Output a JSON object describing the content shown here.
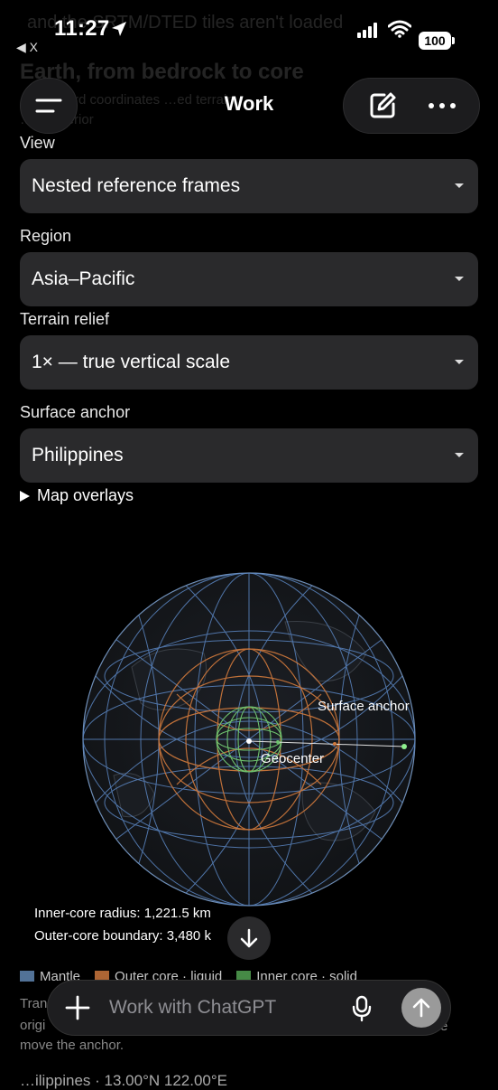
{
  "status": {
    "time": "11:27",
    "back_label": "X",
    "battery": "100"
  },
  "background": {
    "line1": "and the SRTM/DTED tiles aren't loaded",
    "line2": "Earth, from bedrock to core",
    "line3": "…standard coordinates …ed terrain …",
    "line4": "…ed interior"
  },
  "header": {
    "title": "Work"
  },
  "form": {
    "view_label": "View",
    "view_value": "Nested reference frames",
    "region_label": "Region",
    "region_value": "Asia–Pacific",
    "terrain_label": "Terrain relief",
    "terrain_value": "1× — true vertical scale",
    "anchor_label": "Surface anchor",
    "anchor_value": "Philippines",
    "overlays_label": "Map overlays"
  },
  "globe": {
    "surface_anchor_label": "Surface anchor",
    "geocenter_label": "Geocenter",
    "inner_core_text": "Inner-core radius: 1,221.5 km",
    "outer_core_text": "Outer-core boundary: 3,480 k"
  },
  "legend": {
    "items": [
      {
        "label": "Mantle",
        "color": "#5b7fa8"
      },
      {
        "label": "Outer core · liquid",
        "color": "#c0703a"
      },
      {
        "label": "Inner core · solid",
        "color": "#4e9a4e"
      }
    ]
  },
  "partial": {
    "line1": "Tran",
    "line1_tail": "e",
    "line2": "origi",
    "line3": "move the anchor.",
    "bottom": "…ilippines · 13.00°N 122.00°E"
  },
  "composer": {
    "placeholder": "Work with ChatGPT"
  },
  "colors": {
    "mantle": "#5b86c2",
    "outer_core": "#d27a3c",
    "inner_core": "#6ec26e"
  }
}
